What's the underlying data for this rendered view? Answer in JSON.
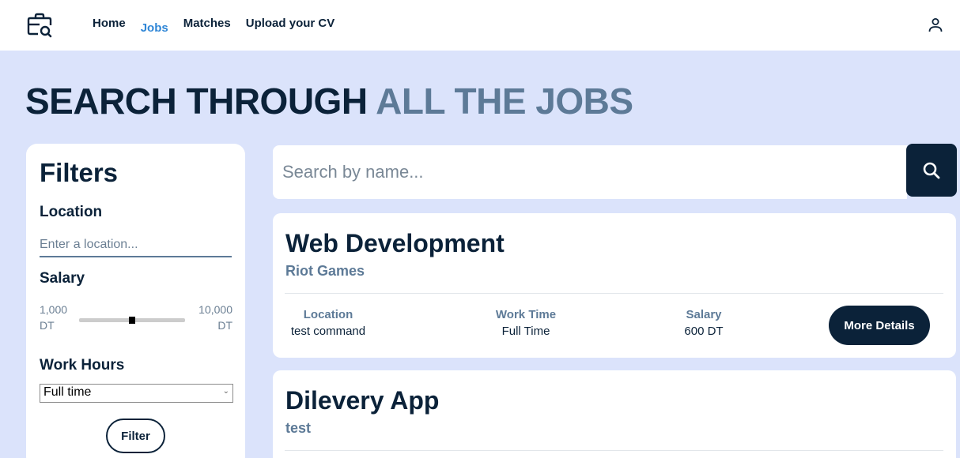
{
  "nav": {
    "logo_icon": "briefcase-search-icon",
    "items": [
      {
        "label": "Home",
        "active": false
      },
      {
        "label": "Jobs",
        "active": true
      },
      {
        "label": "Matches",
        "active": false
      },
      {
        "label": "Upload your CV",
        "active": false
      }
    ],
    "user_icon": "user-icon"
  },
  "hero": {
    "title_dark": "SEARCH THROUGH",
    "title_light": "ALL THE JOBS"
  },
  "filters": {
    "title": "Filters",
    "location_label": "Location",
    "location_placeholder": "Enter a location...",
    "salary_label": "Salary",
    "salary_min_value": "1,000",
    "salary_min_unit": "DT",
    "salary_max_value": "10,000",
    "salary_max_unit": "DT",
    "salary_slider_fraction": 0.5,
    "work_hours_label": "Work Hours",
    "work_hours_selected": "Full time",
    "filter_button": "Filter"
  },
  "search": {
    "placeholder": "Search by name...",
    "button_icon": "search-icon"
  },
  "jobs": [
    {
      "title": "Web Development",
      "company": "Riot Games",
      "location_label": "Location",
      "location": "test command",
      "work_time_label": "Work Time",
      "work_time": "Full Time",
      "salary_label": "Salary",
      "salary": "600 DT",
      "details_button": "More Details"
    },
    {
      "title": "Dilevery App",
      "company": "test"
    }
  ],
  "colors": {
    "primary": "#0b2239",
    "accent": "#2f86d6",
    "muted": "#5d7a97",
    "background": "#dbe3fb"
  }
}
